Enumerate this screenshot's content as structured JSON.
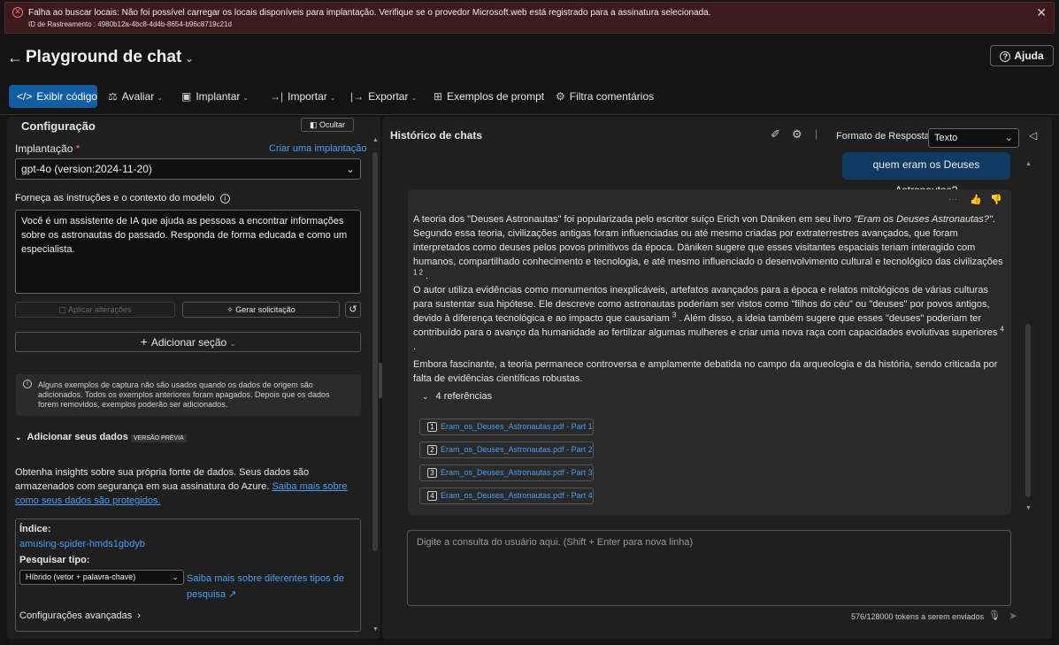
{
  "error": {
    "message": "Falha ao buscar locais: Não foi possível carregar os locais disponíveis para implantação. Verifique se o provedor Microsoft.web está registrado para a assinatura selecionada.",
    "tracking": "ID de Rastreamento : 4980b12a-4bc8-4d4b-8654-b96c8719c21d"
  },
  "header": {
    "title": "Playground de chat",
    "help": "Ajuda"
  },
  "toolbar": {
    "view_code": "Exibir código",
    "evaluate": "Avaliar",
    "deploy": "Implantar",
    "import": "Importar",
    "export": "Exportar",
    "prompt_samples": "Exemplos de prompt",
    "filter_comments": "Filtra comentários"
  },
  "config": {
    "title": "Configuração",
    "hide": "Ocultar",
    "deployment_label": "Implantação",
    "required": "*",
    "create_deployment": "Criar uma implantação",
    "deployment_value": "gpt-4o (version:2024-11-20)",
    "instructions_label": "Forneça as instruções e o contexto do modelo",
    "system_message": "Você é um assistente de IA que ajuda as pessoas a encontrar informações sobre os astronautas do passado. Responda de forma educada e como um especialista.",
    "apply_changes": "Aplicar alterações",
    "generate_prompt": "Gerar solicitação",
    "add_section": "Adicionar seção",
    "note": "Alguns exemplos de captura não são usados quando os dados de origem são adicionados. Todos os exemplos anteriores foram apagados. Depois que os dados forem removidos, exemplos poderão ser adicionados."
  },
  "add_data": {
    "title": "Adicionar seus dados",
    "badge": "VERSÃO PRÉVIA",
    "description": "Obtenha insights sobre sua própria fonte de dados. Seus dados são armazenados com segurança em sua assinatura do Azure.",
    "learn_more": "Saiba mais sobre como seus dados são protegidos.",
    "index_label": "Índice:",
    "index_value": "amusing-spider-hmds1gbdyb",
    "search_type_label": "Pesquisar tipo:",
    "search_type_value": "Híbrido (vetor + palavra-chave)",
    "search_type_link": "Saiba mais sobre diferentes tipos de pesquisa",
    "advanced": "Configurações avançadas"
  },
  "chat": {
    "title": "Histórico de chats",
    "response_format_label": "Formato de Resposta",
    "response_format_value": "Texto",
    "user_message": "quem eram os Deuses Astronautas?",
    "p1a": "A teoria dos \"Deuses Astronautas\" foi popularizada pelo escritor suíço Erich von Däniken em seu livro ",
    "p1b": "\"Eram os Deuses Astronautas?\"",
    "p1c": ". Segundo essa teoria, civilizações antigas foram influenciadas ou até mesmo criadas por extraterrestres avançados, que foram interpretados como deuses pelos povos primitivos da época. Däniken sugere que esses visitantes espaciais teriam interagido com humanos, compartilhado conhecimento e tecnologia, e até mesmo influenciado o desenvolvimento cultural e tecnológico das civilizações ",
    "sup1": "1 2",
    "p2a": "O autor utiliza evidências como monumentos inexplicáveis, artefatos avançados para a época e relatos mitológicos de várias culturas para sustentar sua hipótese. Ele descreve como astronautas poderiam ser vistos como \"filhos do céu\" ou \"deuses\" por povos antigos, devido à diferença tecnológica e ao impacto que causariam ",
    "sup2": "3",
    "p2b": ". Além disso, a ideia também sugere que esses \"deuses\" poderiam ter contribuído para o avanço da humanidade ao fertilizar algumas mulheres e criar uma nova raça com capacidades evolutivas superiores ",
    "sup3": "4",
    "p3": "Embora fascinante, a teoria permanece controversa e amplamente debatida no campo da arqueologia e da história, sendo criticada por falta de evidências científicas robustas.",
    "refs_label": "4 referências",
    "refs": [
      {
        "n": "1",
        "label": "Eram_os_Deuses_Astronautas.pdf - Part 1"
      },
      {
        "n": "2",
        "label": "Eram_os_Deuses_Astronautas.pdf - Part 2"
      },
      {
        "n": "3",
        "label": "Eram_os_Deuses_Astronautas.pdf - Part 3"
      },
      {
        "n": "4",
        "label": "Eram_os_Deuses_Astronautas.pdf - Part 4"
      }
    ],
    "input_placeholder": "Digite a consulta do usuário aqui. (Shift + Enter para nova linha)",
    "token_count": "576/128000 tokens a serem enviados"
  }
}
